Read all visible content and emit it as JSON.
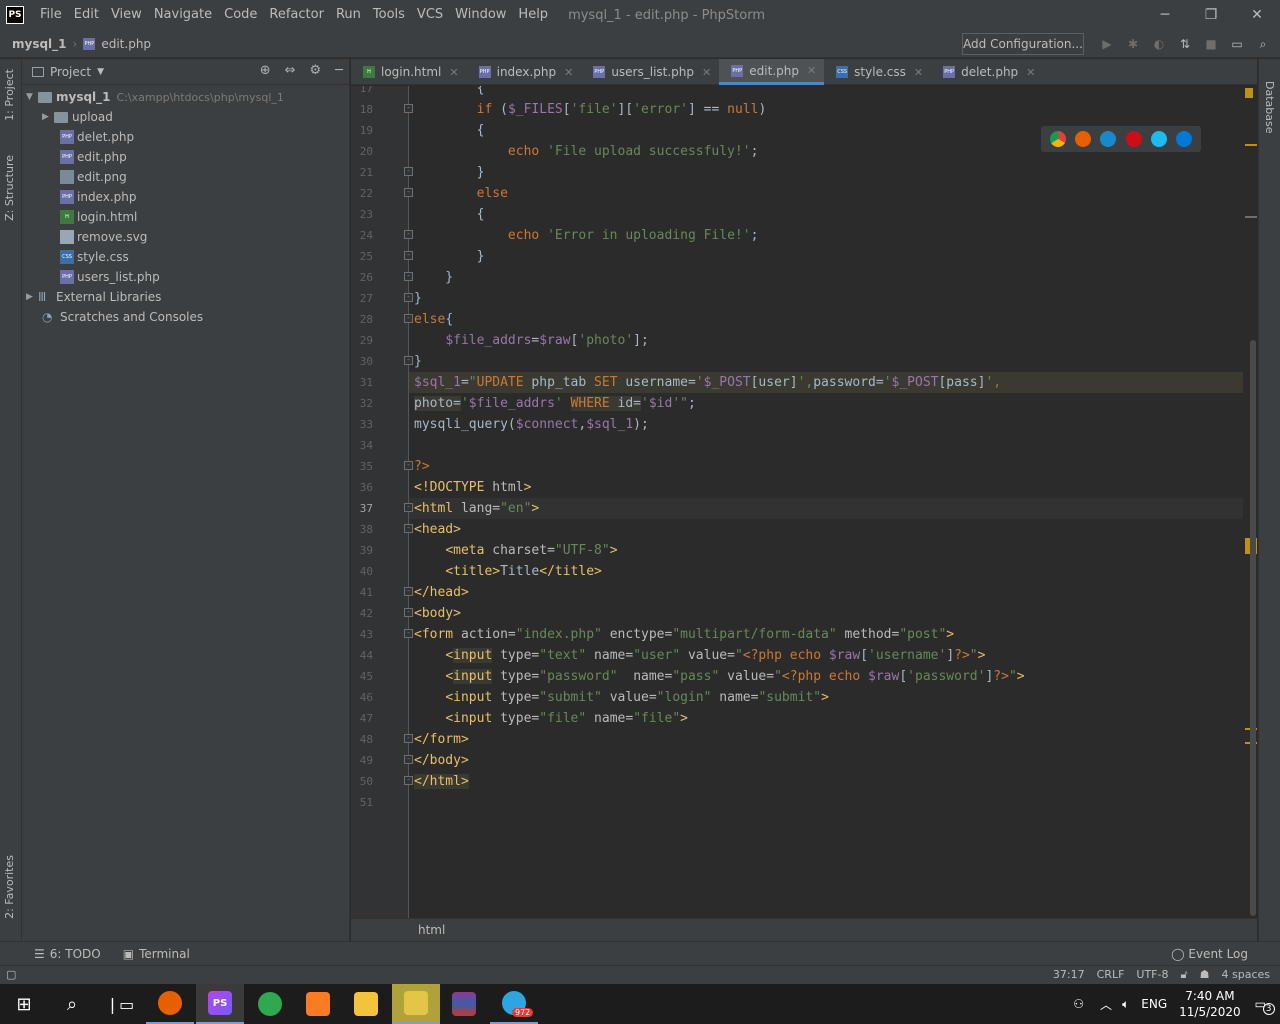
{
  "titlebar": {
    "logo": "PS",
    "menu": [
      "File",
      "Edit",
      "View",
      "Navigate",
      "Code",
      "Refactor",
      "Run",
      "Tools",
      "VCS",
      "Window",
      "Help"
    ],
    "title": "mysql_1 - edit.php - PhpStorm"
  },
  "navbar": {
    "project": "mysql_1",
    "file": "edit.php",
    "add_configuration": "Add Configuration..."
  },
  "left_tabs": {
    "project": "1: Project",
    "structure": "Z: Structure",
    "favorites": "2: Favorites"
  },
  "right_tabs": {
    "database": "Database"
  },
  "project_panel": {
    "title": "Project",
    "root": {
      "name": "mysql_1",
      "path": "C:\\xampp\\htdocs\\php\\mysql_1"
    },
    "folders": [
      "upload"
    ],
    "files": [
      {
        "name": "delet.php",
        "type": "php"
      },
      {
        "name": "edit.php",
        "type": "php"
      },
      {
        "name": "edit.png",
        "type": "png"
      },
      {
        "name": "index.php",
        "type": "php"
      },
      {
        "name": "login.html",
        "type": "html"
      },
      {
        "name": "remove.svg",
        "type": "svg"
      },
      {
        "name": "style.css",
        "type": "css"
      },
      {
        "name": "users_list.php",
        "type": "php"
      }
    ],
    "external_libraries": "External Libraries",
    "scratches": "Scratches and Consoles"
  },
  "tabs": [
    {
      "label": "login.html",
      "type": "html",
      "active": false
    },
    {
      "label": "index.php",
      "type": "php",
      "active": false
    },
    {
      "label": "users_list.php",
      "type": "php",
      "active": false
    },
    {
      "label": "edit.php",
      "type": "php",
      "active": true
    },
    {
      "label": "style.css",
      "type": "css",
      "active": false
    },
    {
      "label": "delet.php",
      "type": "php",
      "active": false
    }
  ],
  "editor": {
    "line_numbers": [
      "17",
      "18",
      "19",
      "20",
      "21",
      "22",
      "23",
      "24",
      "25",
      "26",
      "27",
      "28",
      "29",
      "30",
      "31",
      "32",
      "33",
      "34",
      "35",
      "36",
      "37",
      "38",
      "39",
      "40",
      "41",
      "42",
      "43",
      "44",
      "45",
      "46",
      "47",
      "48",
      "49",
      "50",
      "51"
    ],
    "current_line": "37",
    "breadcrumb": "html"
  },
  "toolwindows": {
    "todo": "6: TODO",
    "terminal": "Terminal",
    "event_log": "Event Log"
  },
  "statusbar": {
    "position": "37:17",
    "line_sep": "CRLF",
    "encoding": "UTF-8",
    "indent": "4 spaces"
  },
  "taskbar": {
    "apps": [
      "windows-start",
      "search",
      "task-view",
      "firefox",
      "phpstorm",
      "app-green",
      "xampp",
      "file-explorer",
      "app-yellow",
      "winrar",
      "telegram"
    ],
    "telegram_badge": "972",
    "language": "ENG",
    "time": "7:40 AM",
    "date": "11/5/2020",
    "notifications": "3"
  }
}
